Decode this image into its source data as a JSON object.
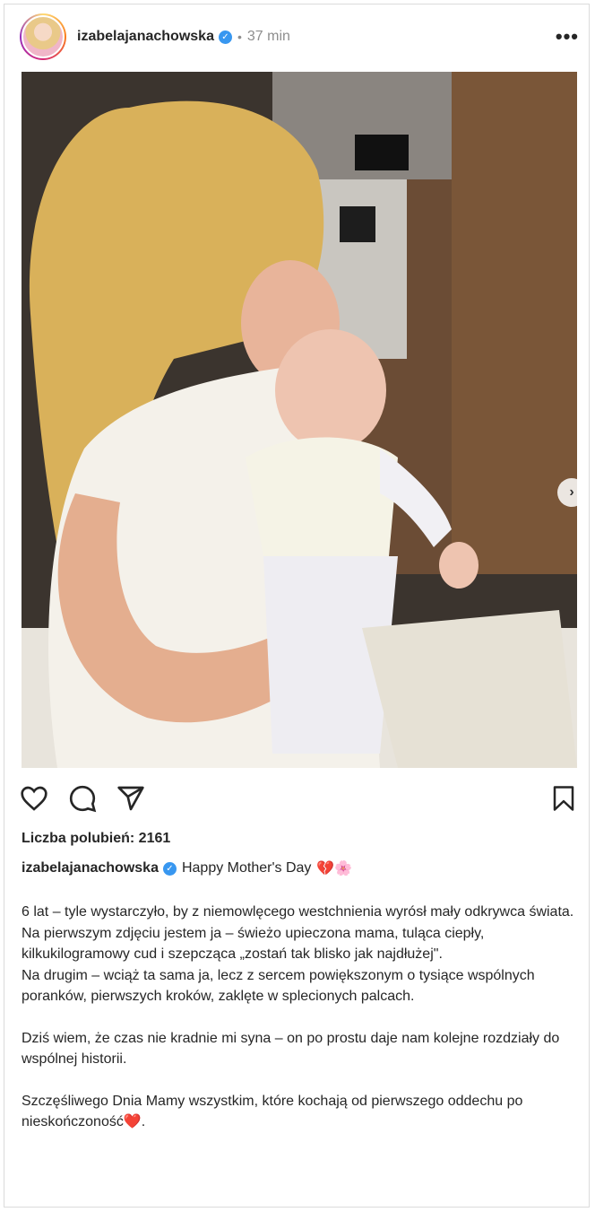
{
  "header": {
    "username": "izabelajanachowska",
    "verified_icon": "verified-badge-icon",
    "separator": "•",
    "time": "37 min",
    "more_icon": "more-options-icon"
  },
  "photo": {
    "next_icon": "chevron-right-icon",
    "next_label": "›"
  },
  "actions": {
    "like_icon": "heart-icon",
    "comment_icon": "comment-icon",
    "share_icon": "share-icon",
    "save_icon": "bookmark-icon"
  },
  "likes": {
    "text": "Liczba polubień: 2161"
  },
  "caption": {
    "username": "izabelajanachowska",
    "headline": "Happy Mother's Day",
    "emojis": "💔🌸",
    "paragraphs": [
      "6 lat – tyle wystarczyło, by z niemowlęcego westchnienia wyrósł mały odkrywca świata.",
      "Na pierwszym zdjęciu jestem ja – świeżo upieczona mama, tuląca ciepły, kilkukilogramowy cud i szepcząca „zostań tak blisko jak najdłużej\".",
      "Na drugim – wciąż ta sama ja, lecz z sercem powiększonym o tysiące wspólnych poranków, pierwszych kroków, zaklęte w splecionych palcach.",
      "",
      "Dziś wiem, że czas nie kradnie mi syna – on po prostu daje nam kolejne rozdziały do wspólnej historii.",
      "",
      "Szczęśliwego Dnia Mamy wszystkim, które kochają od pierwszego oddechu po nieskończoność❤️."
    ]
  },
  "colors": {
    "text": "#262626",
    "muted": "#8e8e8e",
    "verified": "#3897f0"
  }
}
